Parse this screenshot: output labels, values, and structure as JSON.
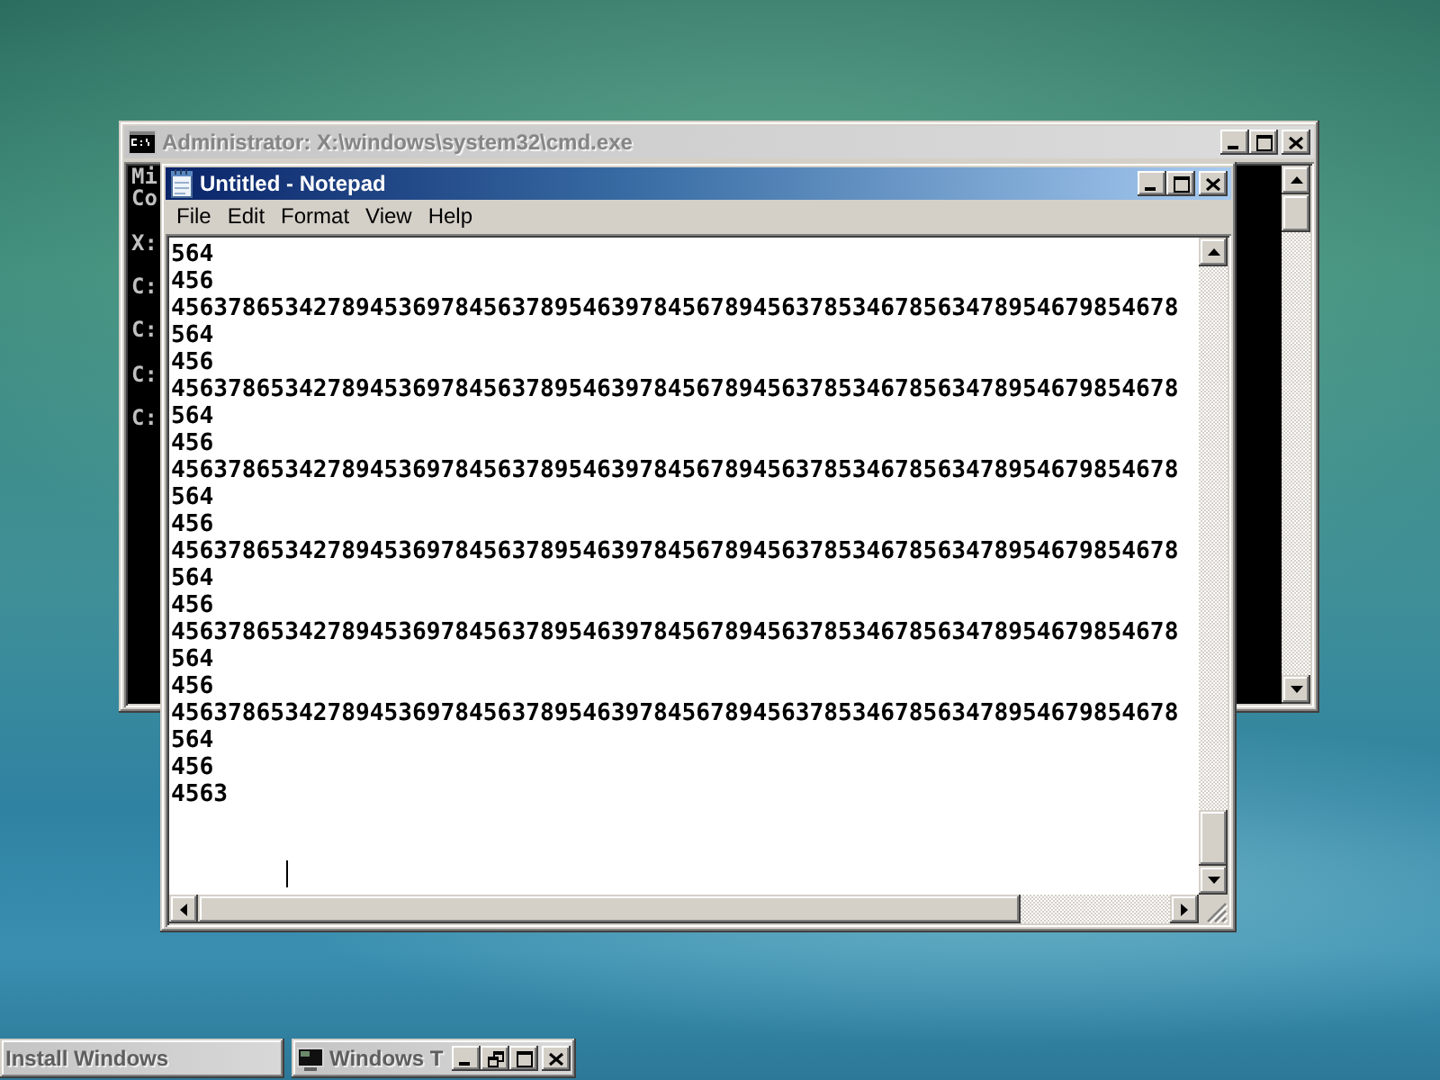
{
  "windows": [
    {
      "kind": "console",
      "active": false,
      "title": "Administrator: X:\\windows\\system32\\cmd.exe",
      "console_blocks": [
        [
          "Mi",
          "Co"
        ],
        [
          "X:"
        ],
        [
          "C:"
        ],
        [
          "C:"
        ],
        [
          "C:"
        ],
        [
          "C:"
        ]
      ]
    },
    {
      "kind": "notepad",
      "active": true,
      "title": "Untitled - Notepad",
      "menu": [
        "File",
        "Edit",
        "Format",
        "View",
        "Help"
      ],
      "text_lines": [
        "564",
        "456",
        "45637865342789453697845637895463978456789456378534678563478954679854678",
        "564",
        "456",
        "45637865342789453697845637895463978456789456378534678563478954679854678",
        "564",
        "456",
        "45637865342789453697845637895463978456789456378534678563478954679854678",
        "564",
        "456",
        "45637865342789453697845637895463978456789456378534678563478954679854678",
        "564",
        "456",
        "45637865342789453697845637895463978456789456378534678563478954679854678",
        "564",
        "456",
        "45637865342789453697845637895463978456789456378534678563478954679854678",
        "564",
        "456",
        "4563"
      ]
    }
  ],
  "minimized_windows": [
    {
      "kind": "dialog",
      "title": "Install Windows"
    },
    {
      "kind": "window",
      "title": "Windows T"
    }
  ]
}
